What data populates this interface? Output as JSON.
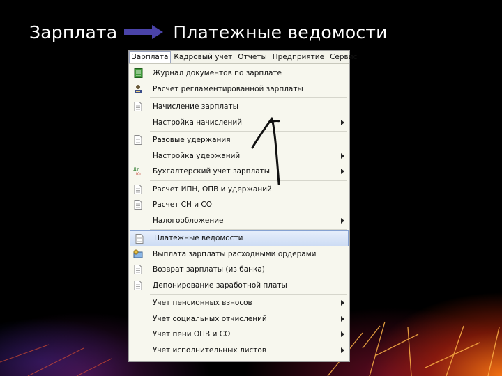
{
  "slide": {
    "title_left": "Зарплата",
    "title_right": "Платежные ведомости"
  },
  "menubar": [
    {
      "label": "Зарплата",
      "active": true
    },
    {
      "label": "Кадровый учет"
    },
    {
      "label": "Отчеты"
    },
    {
      "label": "Предприятие"
    },
    {
      "label": "Сервис"
    }
  ],
  "menu_items": [
    {
      "label": "Журнал документов по зарплате",
      "icon": "journal-icon"
    },
    {
      "label": "Расчет регламентированной зарплаты",
      "icon": "calculation-icon"
    },
    {
      "label": "Начисление зарплаты",
      "icon": "document-icon"
    },
    {
      "label": "Настройка начислений",
      "submenu": true
    },
    {
      "label": "Разовые удержания",
      "icon": "document-icon"
    },
    {
      "label": "Настройка удержаний",
      "submenu": true
    },
    {
      "label": "Бухгалтерский учет зарплаты",
      "icon": "accounting-icon",
      "submenu": true
    },
    {
      "label": "Расчет ИПН, ОПВ и удержаний",
      "icon": "document-icon"
    },
    {
      "label": "Расчет СН и СО",
      "icon": "document-icon"
    },
    {
      "label": "Налогообложение",
      "submenu": true
    },
    {
      "label": "Платежные ведомости",
      "icon": "document-icon",
      "highlighted": true
    },
    {
      "label": "Выплата зарплаты расходными ордерами",
      "icon": "payout-icon"
    },
    {
      "label": "Возврат зарплаты (из банка)",
      "icon": "document-icon"
    },
    {
      "label": "Депонирование заработной платы",
      "icon": "document-icon"
    },
    {
      "label": "Учет пенсионных взносов",
      "submenu": true
    },
    {
      "label": "Учет социальных отчислений",
      "submenu": true
    },
    {
      "label": "Учет пени ОПВ и СО",
      "submenu": true
    },
    {
      "label": "Учет исполнительных листов",
      "submenu": true
    }
  ],
  "colors": {
    "highlight": "#cddcf4",
    "title_arrow": "#4a43a8"
  }
}
